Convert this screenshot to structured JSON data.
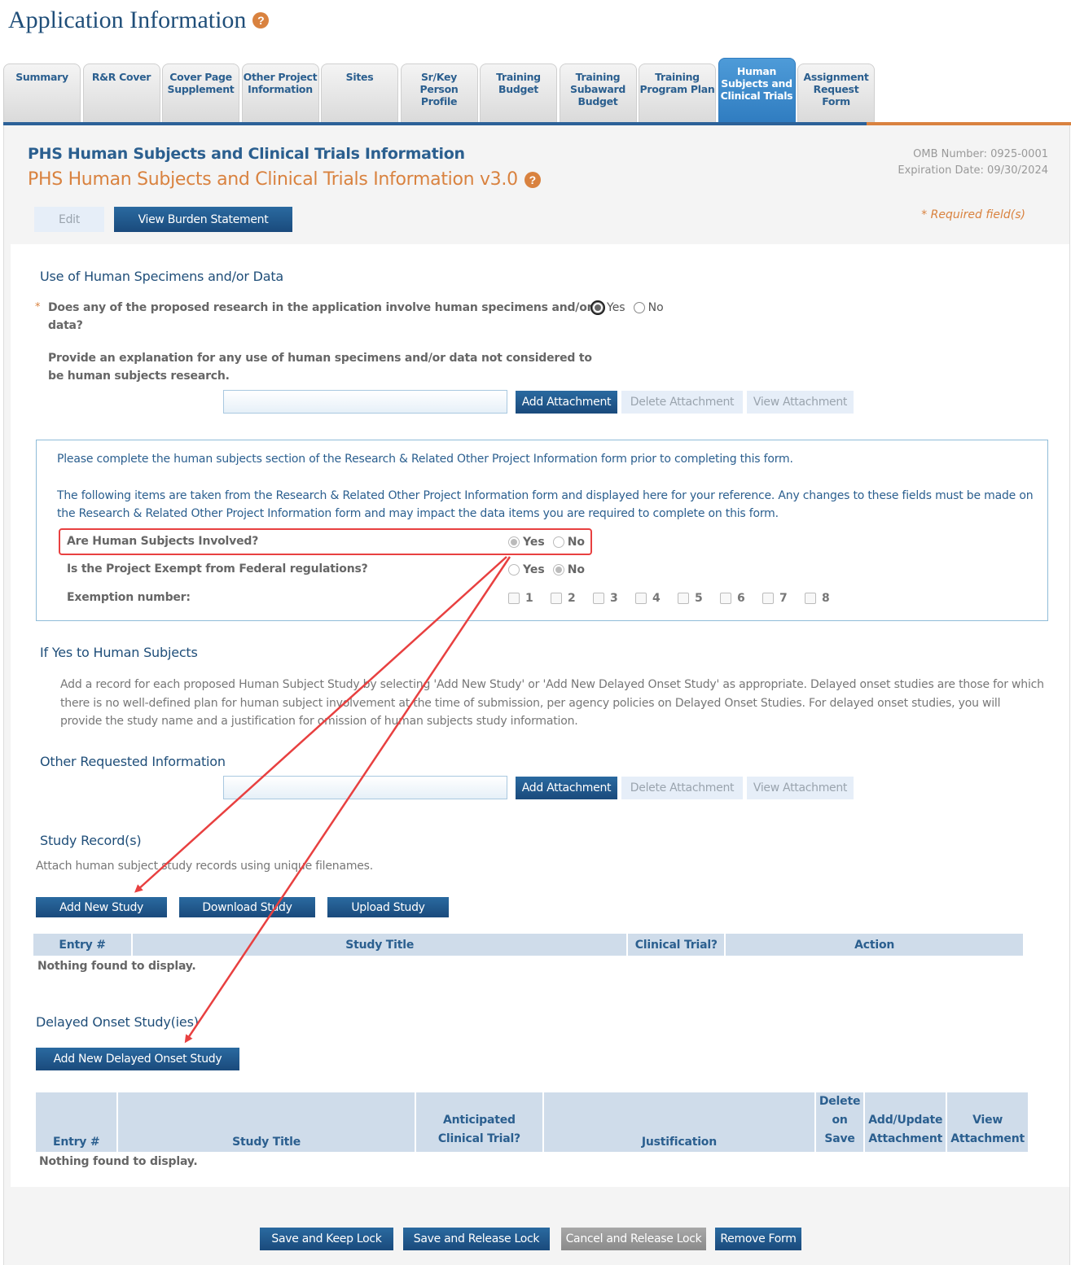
{
  "page": {
    "title": "Application Information",
    "help_icon": "?"
  },
  "tabs": [
    {
      "label": "Summary",
      "active": false
    },
    {
      "label": "R&R Cover",
      "active": false
    },
    {
      "label": "Cover Page Supplement",
      "active": false
    },
    {
      "label": "Other Project Information",
      "active": false
    },
    {
      "label": "Sites",
      "active": false
    },
    {
      "label": "Sr/Key Person Profile",
      "active": false
    },
    {
      "label": "Training Budget",
      "active": false
    },
    {
      "label": "Training Subaward Budget",
      "active": false
    },
    {
      "label": "Training Program Plan",
      "active": false
    },
    {
      "label": "Human Subjects and Clinical Trials",
      "active": true
    },
    {
      "label": "Assignment Request Form",
      "active": false
    }
  ],
  "form": {
    "title": "PHS Human Subjects and Clinical Trials Information",
    "subtitle": "PHS Human Subjects and Clinical Trials Information v3.0",
    "omb_number": "OMB Number: 0925-0001",
    "expiration": "Expiration Date: 09/30/2024",
    "required_note": "* Required field(s)",
    "edit_label": "Edit",
    "burden_label": "View Burden Statement"
  },
  "specimens": {
    "heading": "Use of Human Specimens and/or Data",
    "required_star": "*",
    "question_line1": "Does any of the proposed research in the application involve human specimens and/or",
    "question_line2": "data?",
    "answer": "Yes",
    "yes_label": "Yes",
    "no_label": "No",
    "explain_line1": "Provide an explanation for any use of human specimens and/or data not considered to",
    "explain_line2": "be human subjects research.",
    "file_value": "",
    "add_attachment": "Add Attachment",
    "delete_attachment": "Delete Attachment",
    "view_attachment": "View Attachment"
  },
  "reference": {
    "note": "Please complete the human subjects section of the Research & Related Other Project Information form prior to completing this form.",
    "info_line1": "The following items are taken from the Research & Related Other Project Information form and displayed here for your reference. Any changes to these fields must be made on",
    "info_line2": "the Research & Related Other Project Information form and may impact the data items you are required to complete on this form.",
    "human_subjects_q": "Are Human Subjects Involved?",
    "human_subjects_answer": "Yes",
    "exempt_q": "Is the Project Exempt from Federal regulations?",
    "exempt_answer": "No",
    "exemption_label": "Exemption number:",
    "yes_label": "Yes",
    "no_label": "No",
    "exemptions": [
      {
        "label": "1",
        "checked": false
      },
      {
        "label": "2",
        "checked": false
      },
      {
        "label": "3",
        "checked": false
      },
      {
        "label": "4",
        "checked": false
      },
      {
        "label": "5",
        "checked": false
      },
      {
        "label": "6",
        "checked": false
      },
      {
        "label": "7",
        "checked": false
      },
      {
        "label": "8",
        "checked": false
      }
    ]
  },
  "if_yes": {
    "heading": "If Yes to Human Subjects",
    "line1": "Add a record for each proposed Human Subject Study by selecting 'Add New Study' or 'Add New Delayed Onset Study' as appropriate. Delayed onset studies are those for which",
    "line2": "there is no well-defined plan for human subject involvement at the time of submission, per agency policies on Delayed Onset Studies. For delayed onset studies, you will",
    "line3": "provide the study name and a justification for omission of human subjects study information."
  },
  "other_info": {
    "heading": "Other Requested Information",
    "file_value": "",
    "add_attachment": "Add Attachment",
    "delete_attachment": "Delete Attachment",
    "view_attachment": "View Attachment"
  },
  "study_records": {
    "heading": "Study Record(s)",
    "description": "Attach human subject study records using unique filenames.",
    "add_new": "Add New Study",
    "download": "Download Study",
    "upload": "Upload Study",
    "columns": [
      "Entry #",
      "Study Title",
      "Clinical Trial?",
      "Action"
    ],
    "rows": [],
    "empty_text": "Nothing found to display."
  },
  "delayed_onset": {
    "heading": "Delayed Onset Study(ies)",
    "add_new": "Add New Delayed Onset Study",
    "columns": [
      "Entry #",
      "Study Title",
      "Anticipated Clinical Trial?",
      "Justification",
      "Delete on Save",
      "Add/Update Attachment",
      "View Attachment"
    ],
    "rows": [],
    "empty_text": "Nothing found to display."
  },
  "footer": {
    "save_keep": "Save and Keep Lock",
    "save_release": "Save and Release Lock",
    "cancel_release": "Cancel and Release Lock",
    "remove_form": "Remove Form"
  },
  "colors": {
    "primary_blue": "#1f4e79",
    "button_blue": "#1a4a7c",
    "accent_orange": "#d9823f",
    "active_tab": "#2f7cc0",
    "header_cell": "#cfdcea",
    "annotation_red": "#e84040"
  }
}
